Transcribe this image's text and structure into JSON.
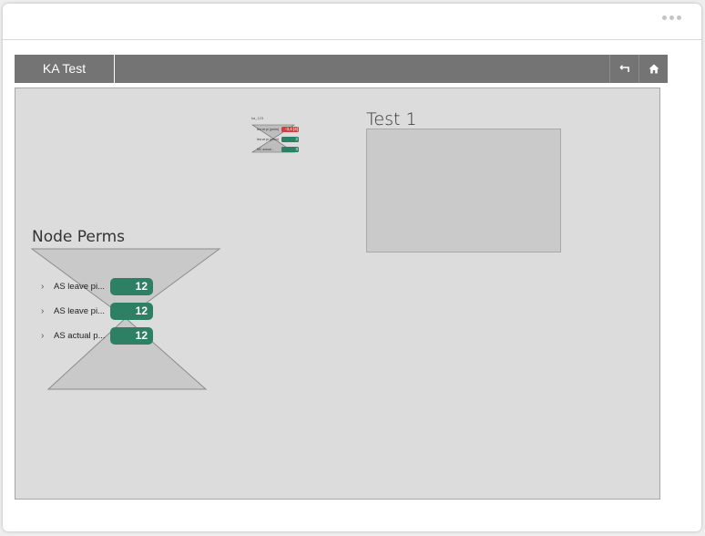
{
  "toolbar": {
    "title": "KA Test",
    "back_icon": "back-arrow-icon",
    "home_icon": "home-icon"
  },
  "header": {
    "menu_icon": "more-dots-icon"
  },
  "canvas": {
    "test": {
      "title": "Test 1"
    },
    "node_perms": {
      "title": "Node Perms",
      "items": [
        {
          "label": "AS leave pi...",
          "value": "12"
        },
        {
          "label": "AS leave pi...",
          "value": "12"
        },
        {
          "label": "AS actual p...",
          "value": "12"
        }
      ]
    },
    "thumbnail": {
      "title": "ka_123",
      "rows": [
        {
          "label": "lea ve pi (perm)",
          "value": "-3,4 [4]",
          "color": "#d04040"
        },
        {
          "label": "lea ve pi (perm)",
          "value": "2",
          "color": "#2e8065"
        },
        {
          "label": "MC actual...",
          "value": "3",
          "color": "#2e8065"
        }
      ]
    }
  },
  "colors": {
    "toolbar_bg": "#747474",
    "badge_green": "#2e8065",
    "badge_red": "#d04040",
    "canvas_bg": "#dcdcdc"
  }
}
